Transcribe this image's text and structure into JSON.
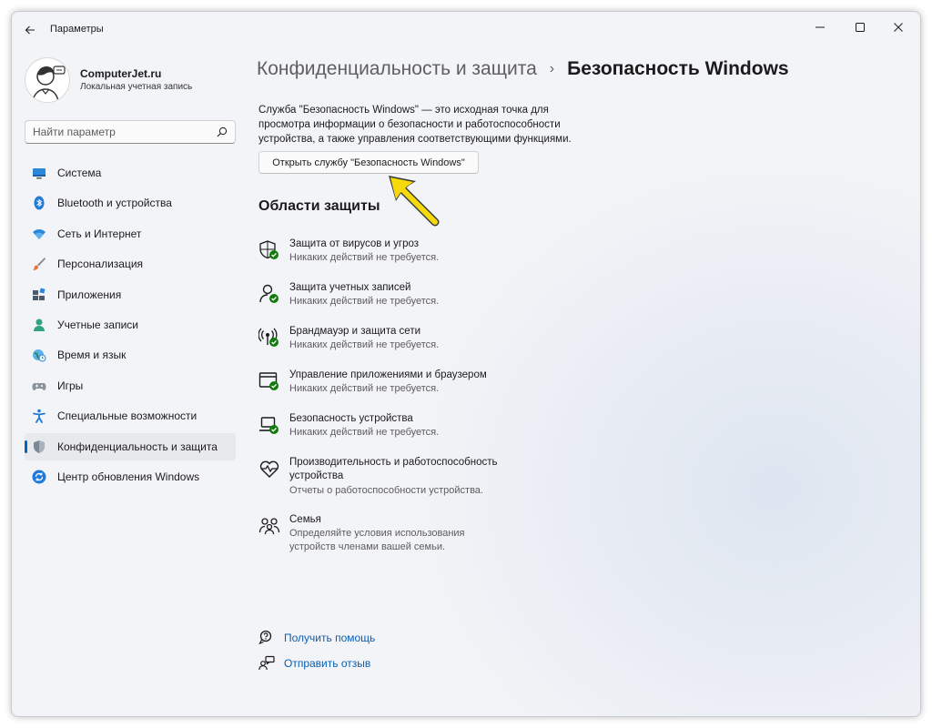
{
  "window": {
    "title": "Параметры"
  },
  "profile": {
    "name": "ComputerJet.ru",
    "account_type": "Локальная учетная запись"
  },
  "search": {
    "placeholder": "Найти параметр",
    "value": ""
  },
  "nav": {
    "items": [
      {
        "label": "Система",
        "icon": "system-icon",
        "active": false
      },
      {
        "label": "Bluetooth и устройства",
        "icon": "bluetooth-icon",
        "active": false
      },
      {
        "label": "Сеть и Интернет",
        "icon": "wifi-icon",
        "active": false
      },
      {
        "label": "Персонализация",
        "icon": "brush-icon",
        "active": false
      },
      {
        "label": "Приложения",
        "icon": "apps-icon",
        "active": false
      },
      {
        "label": "Учетные записи",
        "icon": "accounts-icon",
        "active": false
      },
      {
        "label": "Время и язык",
        "icon": "time-language-icon",
        "active": false
      },
      {
        "label": "Игры",
        "icon": "gamepad-icon",
        "active": false
      },
      {
        "label": "Специальные возможности",
        "icon": "accessibility-icon",
        "active": false
      },
      {
        "label": "Конфиденциальность и защита",
        "icon": "privacy-shield-icon",
        "active": true
      },
      {
        "label": "Центр обновления Windows",
        "icon": "windows-update-icon",
        "active": false
      }
    ]
  },
  "breadcrumb": {
    "parent": "Конфиденциальность и защита",
    "separator": "›",
    "current": "Безопасность Windows"
  },
  "description": "Служба \"Безопасность Windows\" — это исходная точка для просмотра информации о безопасности и работоспособности устройства, а также управления соответствующими функциями.",
  "open_button": "Открыть службу \"Безопасность Windows\"",
  "section_title": "Области защиты",
  "areas": [
    {
      "name": "Защита от вирусов и угроз",
      "status": "Никаких действий не требуется.",
      "icon": "virus-protection-icon"
    },
    {
      "name": "Защита учетных записей",
      "status": "Никаких действий не требуется.",
      "icon": "account-protection-icon"
    },
    {
      "name": "Брандмауэр и защита сети",
      "status": "Никаких действий не требуется.",
      "icon": "firewall-icon"
    },
    {
      "name": "Управление приложениями и браузером",
      "status": "Никаких действий не требуется.",
      "icon": "app-browser-control-icon"
    },
    {
      "name": "Безопасность устройства",
      "status": "Никаких действий не требуется.",
      "icon": "device-security-icon"
    },
    {
      "name": "Производительность и работоспособность устройства",
      "status": "Отчеты о работоспособности устройства.",
      "icon": "device-health-icon"
    },
    {
      "name": "Семья",
      "status": "Определяйте условия использования устройств членами вашей семьи.",
      "icon": "family-icon"
    }
  ],
  "links": [
    {
      "label": "Получить помощь",
      "icon": "help-icon"
    },
    {
      "label": "Отправить отзыв",
      "icon": "feedback-icon"
    }
  ],
  "colors": {
    "accent": "#0067c0",
    "link": "#0a5eb0",
    "ok_badge": "#107c10",
    "arrow": "#f5d90a"
  }
}
